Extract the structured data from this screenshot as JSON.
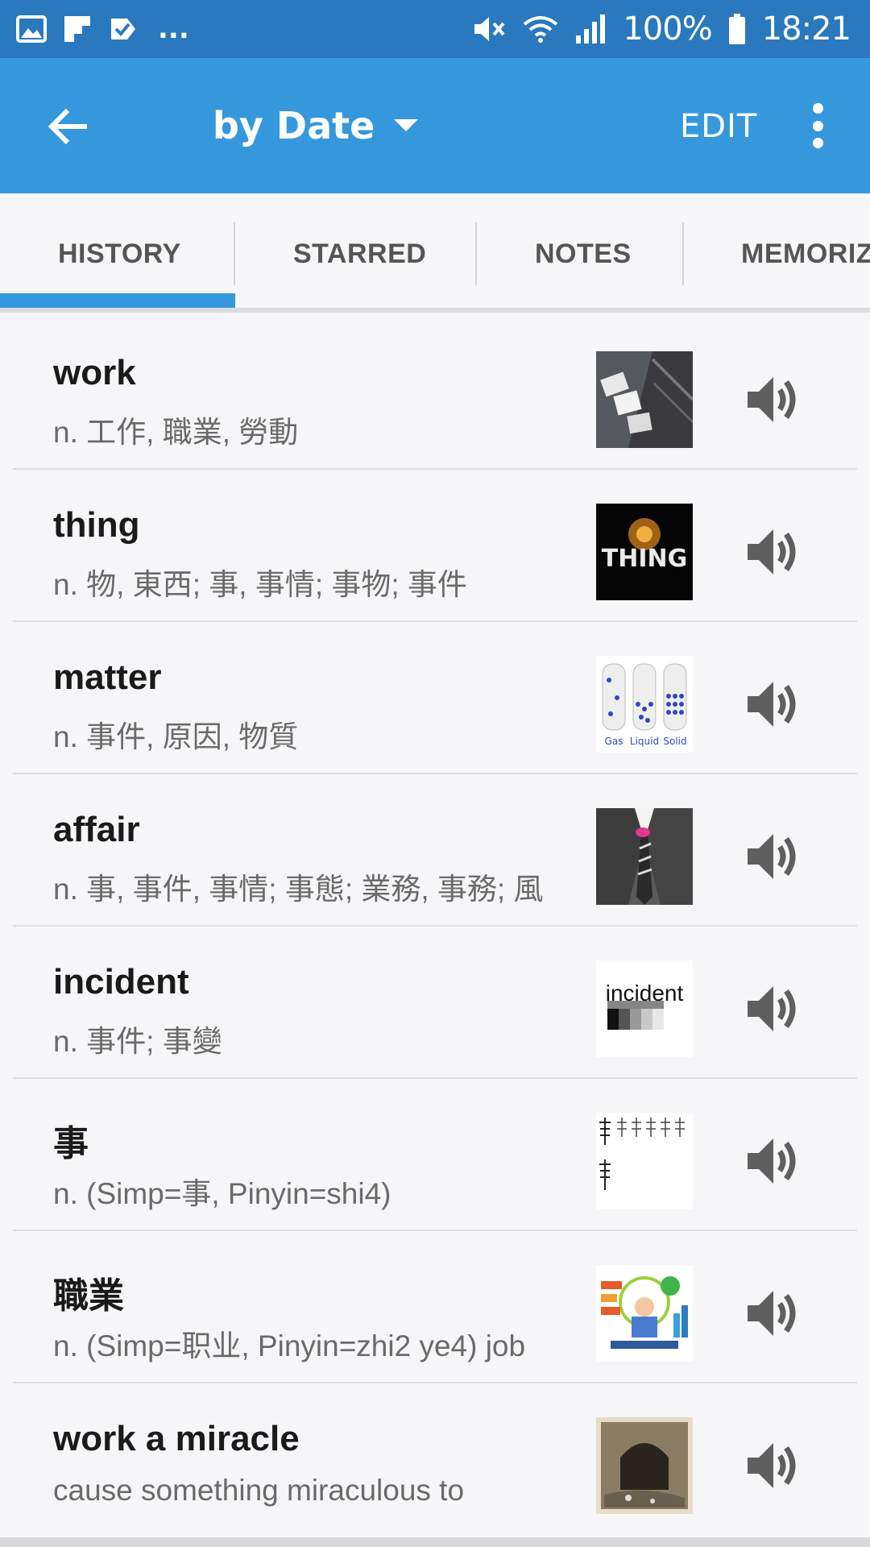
{
  "status_bar": {
    "battery": "100%",
    "time": "18:21",
    "overflow": "..."
  },
  "app_bar": {
    "title": "by Date",
    "edit_label": "EDIT"
  },
  "tabs": [
    {
      "label": "HISTORY",
      "selected": true
    },
    {
      "label": "STARRED",
      "selected": false
    },
    {
      "label": "NOTES",
      "selected": false
    },
    {
      "label": "MEMORIZ",
      "selected": false
    }
  ],
  "colors": {
    "status_bar": "#2a78bd",
    "app_bar": "#3598dc",
    "accent": "#3598dc"
  },
  "entries": [
    {
      "word": "work",
      "definition": "n. 工作, 職業, 勞動",
      "thumbnail": "desk-photo"
    },
    {
      "word": "thing",
      "definition": "n. 物, 東西; 事, 事情; 事物; 事件",
      "thumbnail": "thing-lightbulb",
      "thumb_text": "THING"
    },
    {
      "word": "matter",
      "definition": "n. 事件, 原因, 物質",
      "thumbnail": "states-of-matter",
      "thumb_labels": [
        "Gas",
        "Liquid",
        "Solid"
      ]
    },
    {
      "word": "affair",
      "definition": "n. 事, 事件, 事情; 事態; 業務, 事務; 風",
      "thumbnail": "suit-lipstick"
    },
    {
      "word": "incident",
      "definition": "n. 事件; 事變",
      "thumbnail": "incident-text",
      "thumb_text": "incident"
    },
    {
      "word": "事",
      "definition": "n. (Simp=事, Pinyin=shi4)",
      "thumbnail": "stroke-order"
    },
    {
      "word": "職業",
      "definition": "n. (Simp=职业, Pinyin=zhi2 ye4) job",
      "thumbnail": "career-illustration"
    },
    {
      "word": "work a miracle",
      "definition": "cause something miraculous to",
      "thumbnail": "tunnel-photo"
    }
  ]
}
